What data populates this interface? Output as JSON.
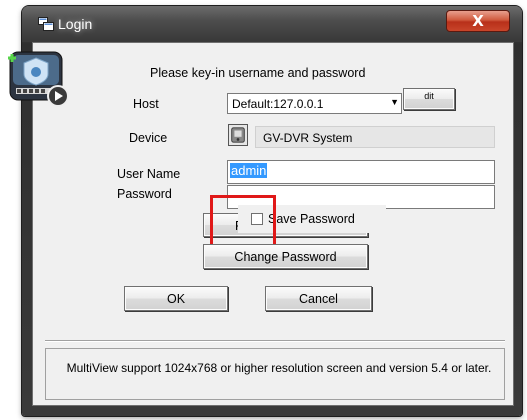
{
  "window": {
    "title": "Login",
    "close_label": "X"
  },
  "prompt": "Please key-in username and password",
  "labels": {
    "host": "Host",
    "device": "Device",
    "user_name": "User Name",
    "password": "Password"
  },
  "host": {
    "value": "Default:127.0.0.1"
  },
  "edit_button_label": "dit",
  "device": {
    "value": "GV-DVR System"
  },
  "user_name": {
    "value": "admin"
  },
  "password": {
    "value": ""
  },
  "forgot_button_label": "Fo",
  "save_password_label": "Save Password",
  "change_password_label": "Change Password",
  "ok_label": "OK",
  "cancel_label": "Cancel",
  "info_text": "MultiView support 1024x768 or higher resolution screen and version 5.4 or later.",
  "colors": {
    "highlight": "#e01818",
    "selection": "#3399ff"
  },
  "icons": {
    "app": "multiview-app-icon",
    "title": "login-window-icon",
    "device": "device-icon"
  }
}
